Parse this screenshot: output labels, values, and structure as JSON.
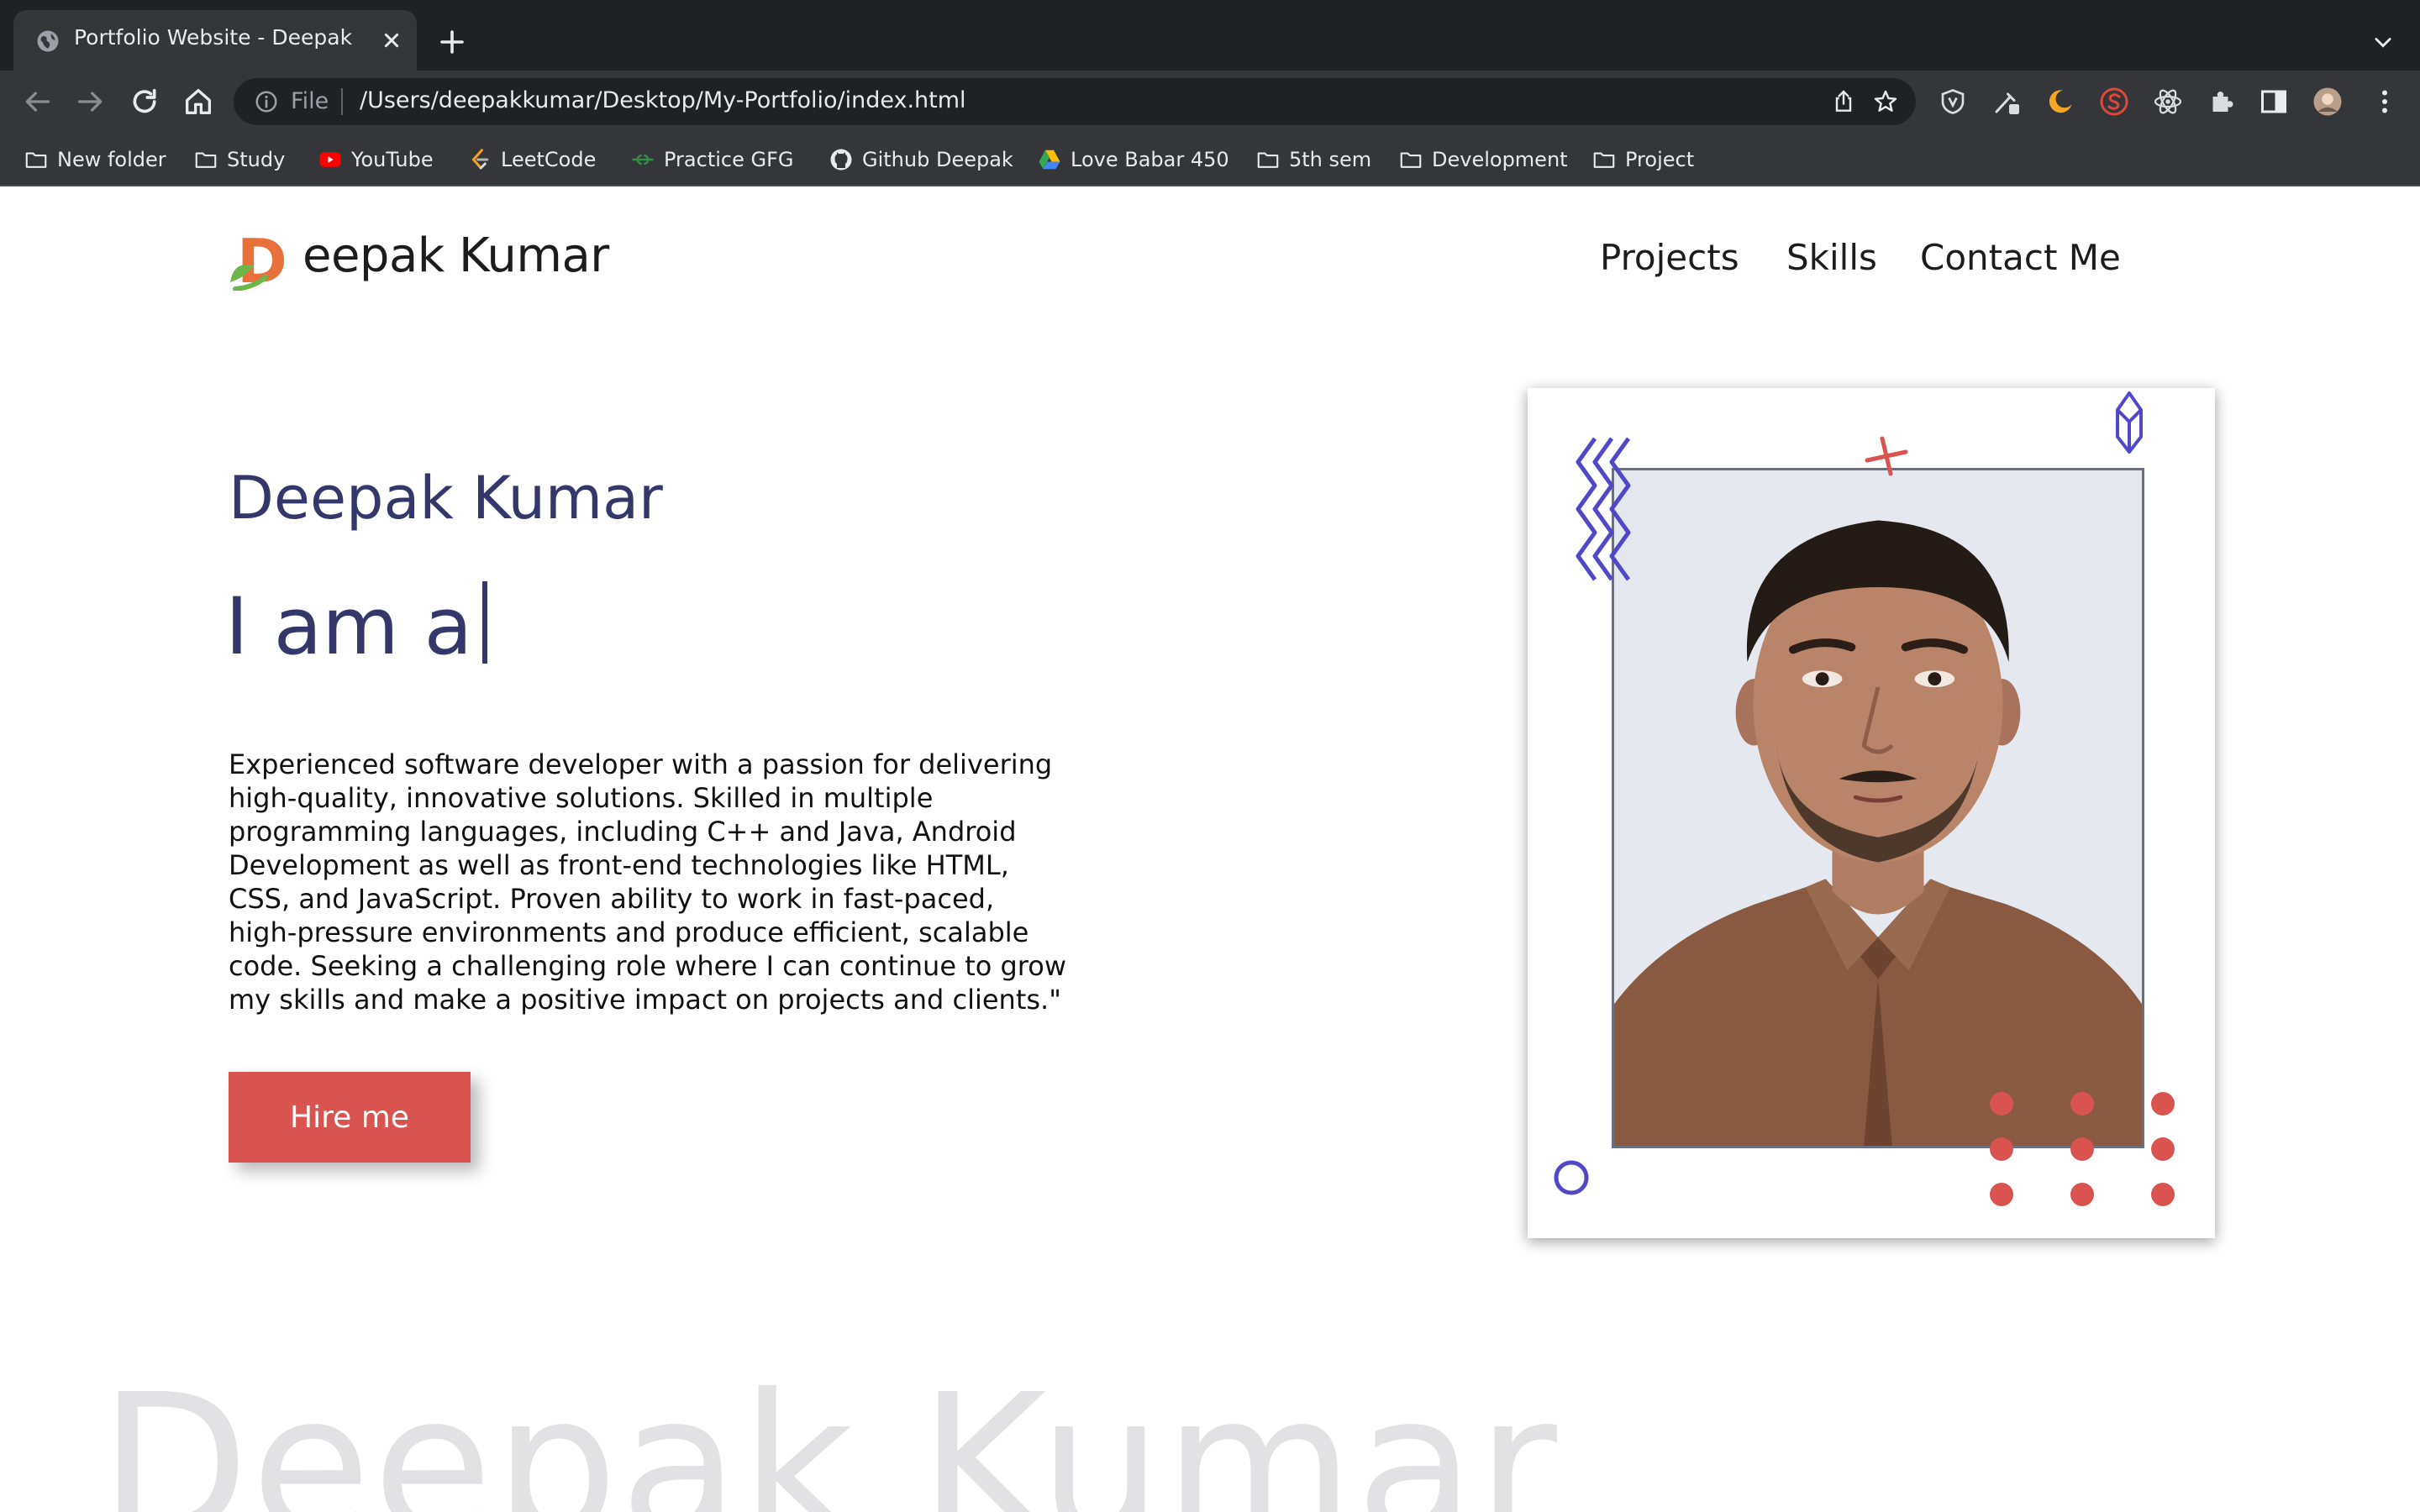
{
  "browser": {
    "tab_title": "Portfolio Website - Deepak",
    "omnibox": {
      "scheme_label": "File",
      "url": "/Users/deepakkumar/Desktop/My-Portfolio/index.html"
    },
    "bookmarks": [
      {
        "label": "New folder",
        "icon": "folder-icon"
      },
      {
        "label": "Study",
        "icon": "folder-icon"
      },
      {
        "label": "YouTube",
        "icon": "youtube-icon"
      },
      {
        "label": "LeetCode",
        "icon": "leetcode-icon"
      },
      {
        "label": "Practice GFG",
        "icon": "gfg-icon"
      },
      {
        "label": "Github Deepak",
        "icon": "github-icon"
      },
      {
        "label": "Love Babar 450",
        "icon": "google-drive-icon"
      },
      {
        "label": "5th sem",
        "icon": "folder-icon"
      },
      {
        "label": "Development",
        "icon": "folder-icon"
      },
      {
        "label": "Project",
        "icon": "folder-icon"
      }
    ],
    "colors": {
      "tabstrip": "#202124",
      "toolbar": "#35363a",
      "text": "#e8eaed"
    }
  },
  "site": {
    "logo_letter": "D",
    "logo_text": "eepak Kumar",
    "nav": [
      "Projects",
      "Skills",
      "Contact Me"
    ],
    "hero": {
      "name": "Deepak Kumar",
      "typed_prefix": "I am a",
      "description": "Experienced software developer with a passion for delivering high-quality, innovative solutions. Skilled in multiple programming languages, including C++ and Java, Android Development as well as front-end technologies like HTML, CSS, and JavaScript. Proven ability to work in fast-paced, high-pressure environments and produce efficient, scalable code. Seeking a challenging role where I can continue to grow my skills and make a positive impact on projects and clients.\"",
      "cta": "Hire me"
    },
    "background_text": "Deepak Kumar",
    "colors": {
      "accent": "#d9534f",
      "heading": "#34376a",
      "decoration_blue": "#5048c9",
      "logo_orange": "#e8703a",
      "logo_green": "#6cb64a"
    }
  }
}
